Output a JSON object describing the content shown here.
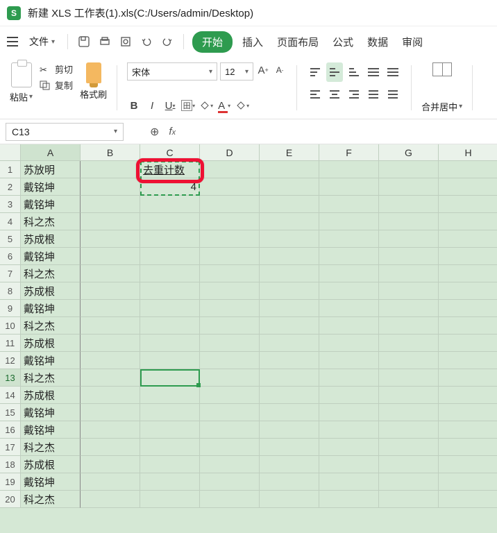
{
  "titlebar": {
    "app_badge": "S",
    "title": "新建 XLS 工作表(1).xls(C:/Users/admin/Desktop)"
  },
  "ribbon": {
    "file_label": "文件",
    "tabs": {
      "start": "开始",
      "insert": "插入",
      "layout": "页面布局",
      "formula": "公式",
      "data": "数据",
      "review": "审阅"
    },
    "clipboard": {
      "paste": "粘贴",
      "cut": "剪切",
      "copy": "复制",
      "format_painter": "格式刷"
    },
    "font": {
      "name": "宋体",
      "size": "12",
      "bold": "B",
      "italic": "I",
      "underline": "U"
    },
    "merge": {
      "label": "合并居中"
    }
  },
  "namebox": {
    "value": "C13"
  },
  "columns": [
    "A",
    "B",
    "C",
    "D",
    "E",
    "F",
    "G",
    "H"
  ],
  "row_count": 20,
  "active_row": 13,
  "colA": [
    "苏放明",
    "戴铭坤",
    "戴铭坤",
    "科之杰",
    "苏成根",
    "戴铭坤",
    "科之杰",
    "苏成根",
    "戴铭坤",
    "科之杰",
    "苏成根",
    "戴铭坤",
    "科之杰",
    "苏成根",
    "戴铭坤",
    "戴铭坤",
    "科之杰",
    "苏成根",
    "戴铭坤",
    "科之杰"
  ],
  "c1_label": "去重计数",
  "c2_value": "4"
}
